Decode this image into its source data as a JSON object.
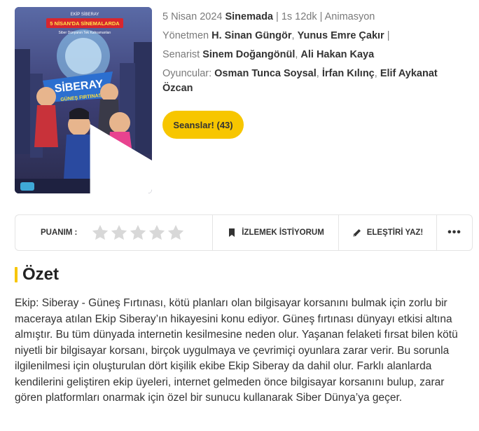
{
  "poster": {
    "top_text": "EKİP SİBERAY",
    "banner": "5 NİSAN'DA SİNEMALARDA",
    "tagline": "Siber Dünyanın Tek Kahramanları",
    "logo_line1": "EKİP",
    "logo_line2": "SİBERAY",
    "logo_line3": "GÜNEŞ FIRTINASI",
    "play_icon": "play-icon"
  },
  "info": {
    "date": "5 Nisan 2024",
    "status": "Sinemada",
    "duration": "1s 12dk",
    "genre": "Animasyon",
    "director_label": "Yönetmen",
    "directors": [
      "H. Sinan Güngör",
      "Yunus Emre Çakır"
    ],
    "writer_label": "Senarist",
    "writers": [
      "Sinem Doğangönül",
      "Ali Hakan Kaya"
    ],
    "cast_label": "Oyuncular:",
    "cast": [
      "Osman Tunca Soysal",
      "İrfan Kılınç",
      "Elif Aykanat Özcan"
    ]
  },
  "seans_button": "Seanslar! (43)",
  "actions": {
    "rating_label": "PUANIM :",
    "stars_filled": 0,
    "stars_total": 5,
    "watchlist_label": "İZLEMEK İSTİYORUM",
    "review_label": "ELEŞTİRİ YAZ!",
    "more_label": "•••"
  },
  "summary": {
    "title": "Özet",
    "text": "Ekip: Siberay - Güneş Fırtınası, kötü planları olan bilgisayar korsanını bulmak için zorlu bir maceraya atılan Ekip Siberay’ın hikayesini konu ediyor. Güneş fırtınası dünyayı etkisi altına almıştır. Bu tüm dünyada internetin kesilmesine neden olur. Yaşanan felaketi fırsat bilen kötü niyetli bir bilgisayar korsanı, birçok uygulmaya ve çevrimiçi oyunlara zarar verir. Bu sorunla ilgilenilmesi için oluşturulan dört kişilik ekibe Ekip Siberay da dahil olur. Farklı alanlarda kendilerini geliştiren ekip üyeleri, internet gelmeden önce bilgisayar korsanını bulup, zarar gören platformları onarmak için özel bir sunucu kullanarak Siber Dünya’ya geçer."
  },
  "colors": {
    "accent": "#f7c600",
    "border": "#e4e4e4",
    "muted": "#7a7a7a"
  }
}
